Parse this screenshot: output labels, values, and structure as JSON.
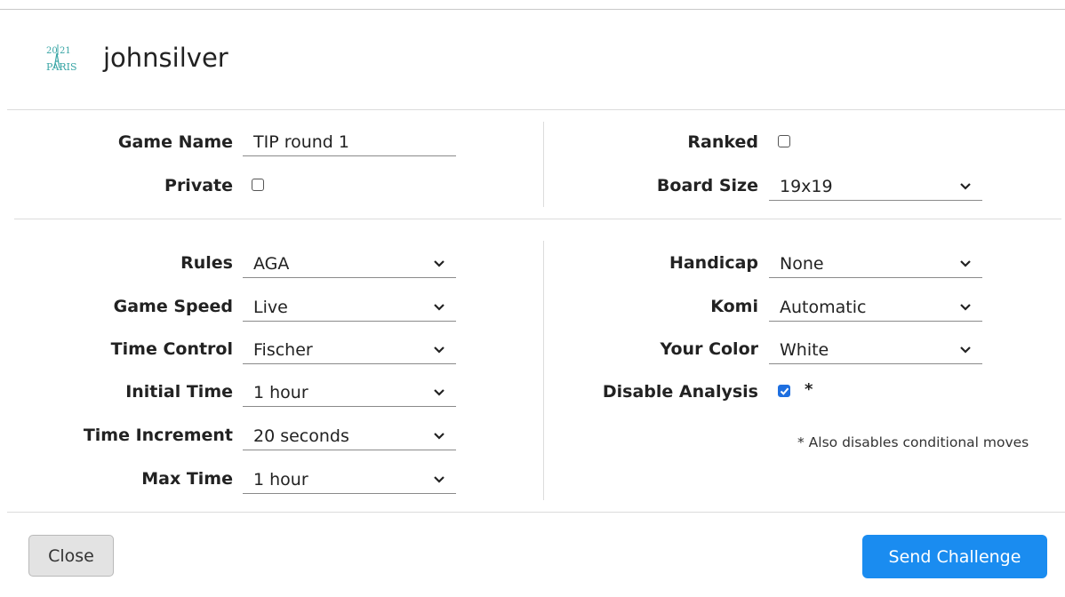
{
  "header": {
    "logo": {
      "year_top": "20",
      "year_bottom": "21",
      "city": "PARIS",
      "color": "#3aa6a6"
    },
    "username": "johnsilver"
  },
  "game_section": {
    "left": {
      "game_name": {
        "label": "Game Name",
        "value": "TIP round 1"
      },
      "private": {
        "label": "Private",
        "checked": false
      }
    },
    "right": {
      "ranked": {
        "label": "Ranked",
        "checked": false
      },
      "board_size": {
        "label": "Board Size",
        "value": "19x19"
      }
    }
  },
  "settings_section": {
    "left": {
      "rules": {
        "label": "Rules",
        "value": "AGA"
      },
      "game_speed": {
        "label": "Game Speed",
        "value": "Live"
      },
      "time_control": {
        "label": "Time Control",
        "value": "Fischer"
      },
      "initial_time": {
        "label": "Initial Time",
        "value": "1 hour"
      },
      "time_increment": {
        "label": "Time Increment",
        "value": "20 seconds"
      },
      "max_time": {
        "label": "Max Time",
        "value": "1 hour"
      }
    },
    "right": {
      "handicap": {
        "label": "Handicap",
        "value": "None"
      },
      "komi": {
        "label": "Komi",
        "value": "Automatic"
      },
      "your_color": {
        "label": "Your Color",
        "value": "White"
      },
      "disable_analysis": {
        "label": "Disable Analysis",
        "checked": true,
        "asterisk": "*"
      },
      "note": "* Also disables conditional moves"
    }
  },
  "footer": {
    "close_label": "Close",
    "send_label": "Send Challenge"
  },
  "colors": {
    "accent": "#1a8cf0",
    "checkbox_checked": "#1e6fe0",
    "divider": "#dcdcdc"
  }
}
